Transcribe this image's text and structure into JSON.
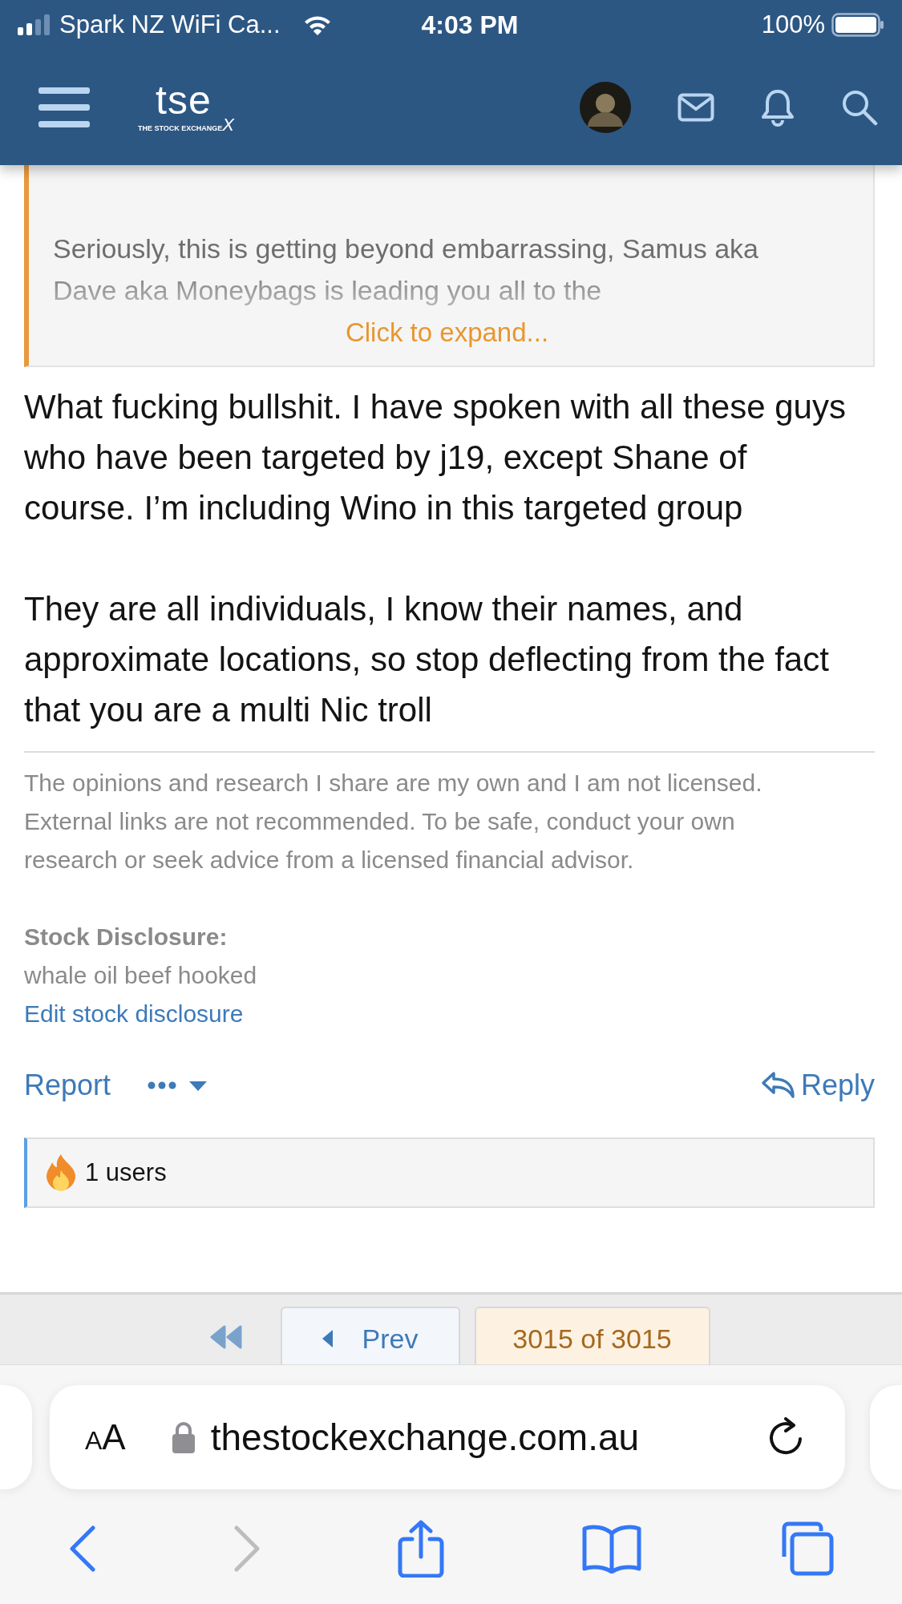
{
  "status_bar": {
    "carrier": "Spark NZ WiFi Ca...",
    "time": "4:03 PM",
    "battery": "100%"
  },
  "header": {
    "logo": {
      "wordmark": "tse",
      "tagline": "THE STOCK EXCHANGE",
      "mark": "X"
    }
  },
  "quote": {
    "text": "Seriously, this is getting beyond embarrassing, Samus aka Dave aka Moneybags is leading you all to the",
    "expand_link": "Click to expand..."
  },
  "post": {
    "paragraphs": [
      "What fucking bullshit. I have spoken with all these guys who have been targeted by j19, except Shane of course. I’m including Wino in this targeted group",
      "They are all individuals, I know their names, and approximate locations, so stop deflecting from the fact that you are a multi Nic troll"
    ]
  },
  "signature": {
    "text": "The opinions and research I share are my own and I am not licensed. External links are not recommended. To be safe, conduct your own research or seek advice from a licensed financial advisor.",
    "disclosure_label": "Stock Disclosure:",
    "disclosure": "whale oil beef hooked",
    "edit_link": "Edit stock disclosure"
  },
  "actions": {
    "report": "Report",
    "reply": "Reply"
  },
  "reactions": {
    "count": "1 users"
  },
  "pagination": {
    "prev": "Prev",
    "current": "3015 of 3015"
  },
  "browser": {
    "text_size": "AA",
    "url": "thestockexchange.com.au",
    "forward_disabled": true
  }
}
